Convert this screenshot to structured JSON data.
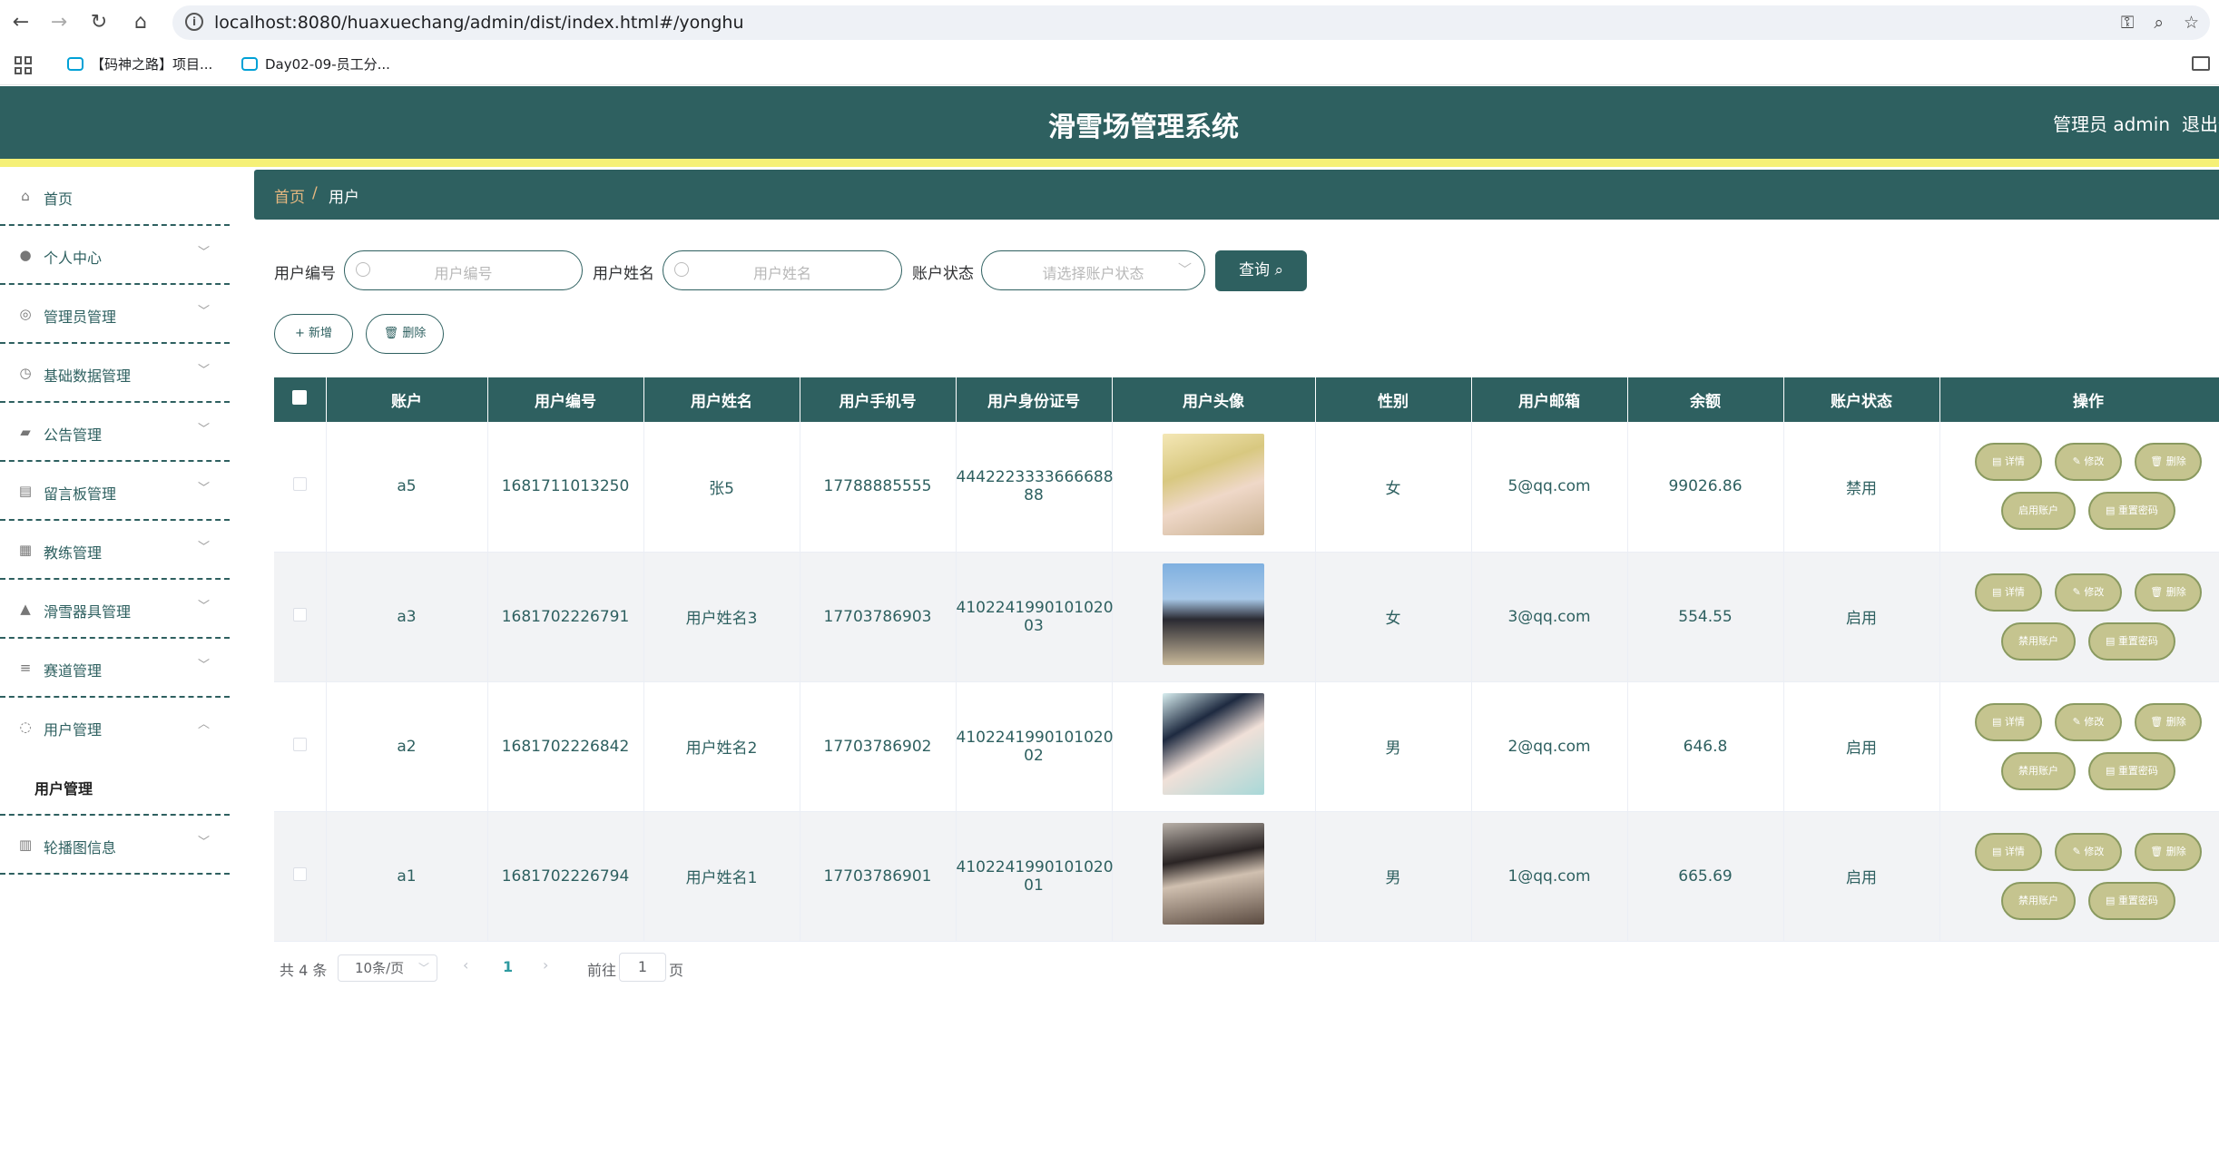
{
  "browser": {
    "url": "localhost:8080/huaxuechang/admin/dist/index.html#/yonghu",
    "bookmarks": [
      "【码神之路】项目...",
      "Day02-09-员工分..."
    ]
  },
  "header": {
    "title": "滑雪场管理系统",
    "admin": "管理员 admin",
    "logout": "退出登录"
  },
  "sidebar": {
    "items": [
      {
        "label": "首页",
        "icon": "home-icon"
      },
      {
        "label": "个人中心",
        "icon": "user-icon"
      },
      {
        "label": "管理员管理",
        "icon": "admin-icon"
      },
      {
        "label": "基础数据管理",
        "icon": "clock-icon"
      },
      {
        "label": "公告管理",
        "icon": "notice-icon"
      },
      {
        "label": "留言板管理",
        "icon": "message-icon"
      },
      {
        "label": "教练管理",
        "icon": "grid-icon"
      },
      {
        "label": "滑雪器具管理",
        "icon": "equipment-icon"
      },
      {
        "label": "赛道管理",
        "icon": "list-icon"
      },
      {
        "label": "用户管理",
        "icon": "users-icon"
      },
      {
        "label": "轮播图信息",
        "icon": "carousel-icon"
      }
    ],
    "submenu": "用户管理"
  },
  "breadcrumb": {
    "home": "首页",
    "sep": "/",
    "current": "用户"
  },
  "filters": {
    "code_label": "用户编号",
    "code_placeholder": "用户编号",
    "name_label": "用户姓名",
    "name_placeholder": "用户姓名",
    "status_label": "账户状态",
    "status_placeholder": "请选择账户状态",
    "query": "查询"
  },
  "actions": {
    "add": "+ 新增",
    "delete": "删除"
  },
  "table": {
    "headers": [
      "账户",
      "用户编号",
      "用户姓名",
      "用户手机号",
      "用户身份证号",
      "用户头像",
      "性别",
      "用户邮箱",
      "余额",
      "账户状态",
      "操作"
    ],
    "rows": [
      {
        "account": "a5",
        "code": "1681711013250",
        "name": "张5",
        "phone": "17788885555",
        "idcard_l1": "4442223333666688",
        "idcard_l2": "88",
        "gender": "女",
        "email": "5@qq.com",
        "balance": "99026.86",
        "status": "禁用",
        "toggle": "启用账户"
      },
      {
        "account": "a3",
        "code": "1681702226791",
        "name": "用户姓名3",
        "phone": "17703786903",
        "idcard_l1": "4102241990101020",
        "idcard_l2": "03",
        "gender": "女",
        "email": "3@qq.com",
        "balance": "554.55",
        "status": "启用",
        "toggle": "禁用账户"
      },
      {
        "account": "a2",
        "code": "1681702226842",
        "name": "用户姓名2",
        "phone": "17703786902",
        "idcard_l1": "4102241990101020",
        "idcard_l2": "02",
        "gender": "男",
        "email": "2@qq.com",
        "balance": "646.8",
        "status": "启用",
        "toggle": "禁用账户"
      },
      {
        "account": "a1",
        "code": "1681702226794",
        "name": "用户姓名1",
        "phone": "17703786901",
        "idcard_l1": "4102241990101020",
        "idcard_l2": "01",
        "gender": "男",
        "email": "1@qq.com",
        "balance": "665.69",
        "status": "启用",
        "toggle": "禁用账户"
      }
    ],
    "ops": {
      "detail": "详情",
      "edit": "修改",
      "delete": "删除",
      "reset": "重置密码"
    }
  },
  "pagination": {
    "total": "共 4 条",
    "size": "10条/页",
    "current": "1",
    "goto": "前往",
    "input": "1",
    "page": "页"
  }
}
